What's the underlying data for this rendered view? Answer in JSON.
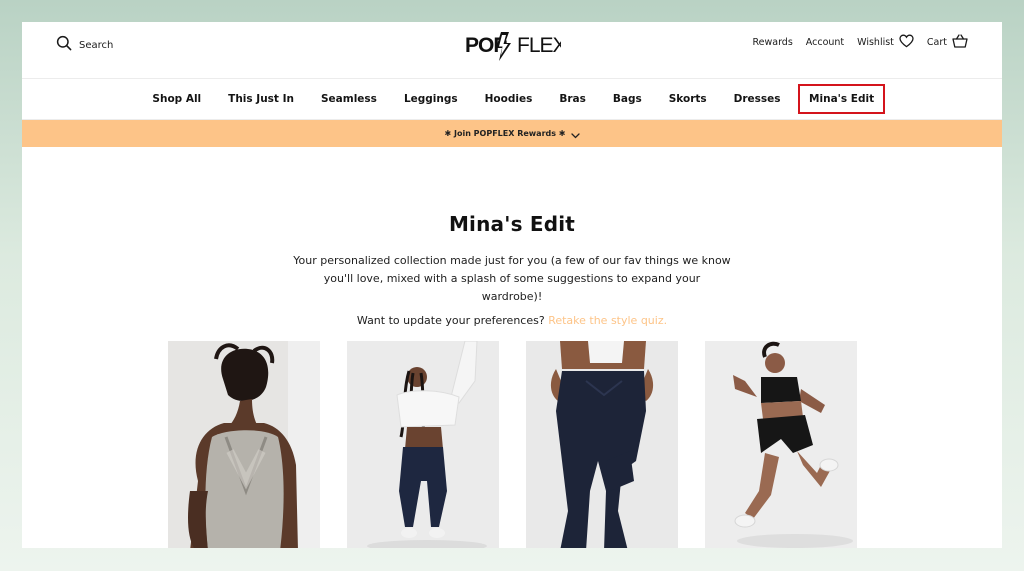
{
  "header": {
    "search_label": "Search",
    "brand_logo_text": "POPFLEX",
    "rewards_label": "Rewards",
    "account_label": "Account",
    "wishlist_label": "Wishlist",
    "cart_label": "Cart"
  },
  "nav": {
    "items": [
      "Shop All",
      "This Just In",
      "Seamless",
      "Leggings",
      "Hoodies",
      "Bras",
      "Bags",
      "Skorts",
      "Dresses",
      "Mina's Edit"
    ],
    "active": "Mina's Edit"
  },
  "promo": {
    "text": "✱ Join POPFLEX Rewards ✱"
  },
  "main": {
    "title": "Mina's Edit",
    "intro": "Your personalized collection made just for you (a few of our fav things we know you'll love, mixed with a splash of some suggestions to expand your wardrobe)!",
    "pref_prompt": "Want to update your preferences?",
    "quiz_link": "Retake the style quiz."
  },
  "products": [
    {
      "image": "ribbed-tank-back-view"
    },
    {
      "image": "white-crop-navy-leggings"
    },
    {
      "image": "navy-flare-pants"
    },
    {
      "image": "black-skort-running"
    }
  ],
  "colors": {
    "accent_peach": "#fdc488",
    "active_outline": "#d4141c",
    "text": "#141414"
  },
  "icons": {
    "search": "search-icon",
    "wishlist": "heart-icon",
    "cart": "basket-icon",
    "promo": "chevron-down-icon"
  }
}
